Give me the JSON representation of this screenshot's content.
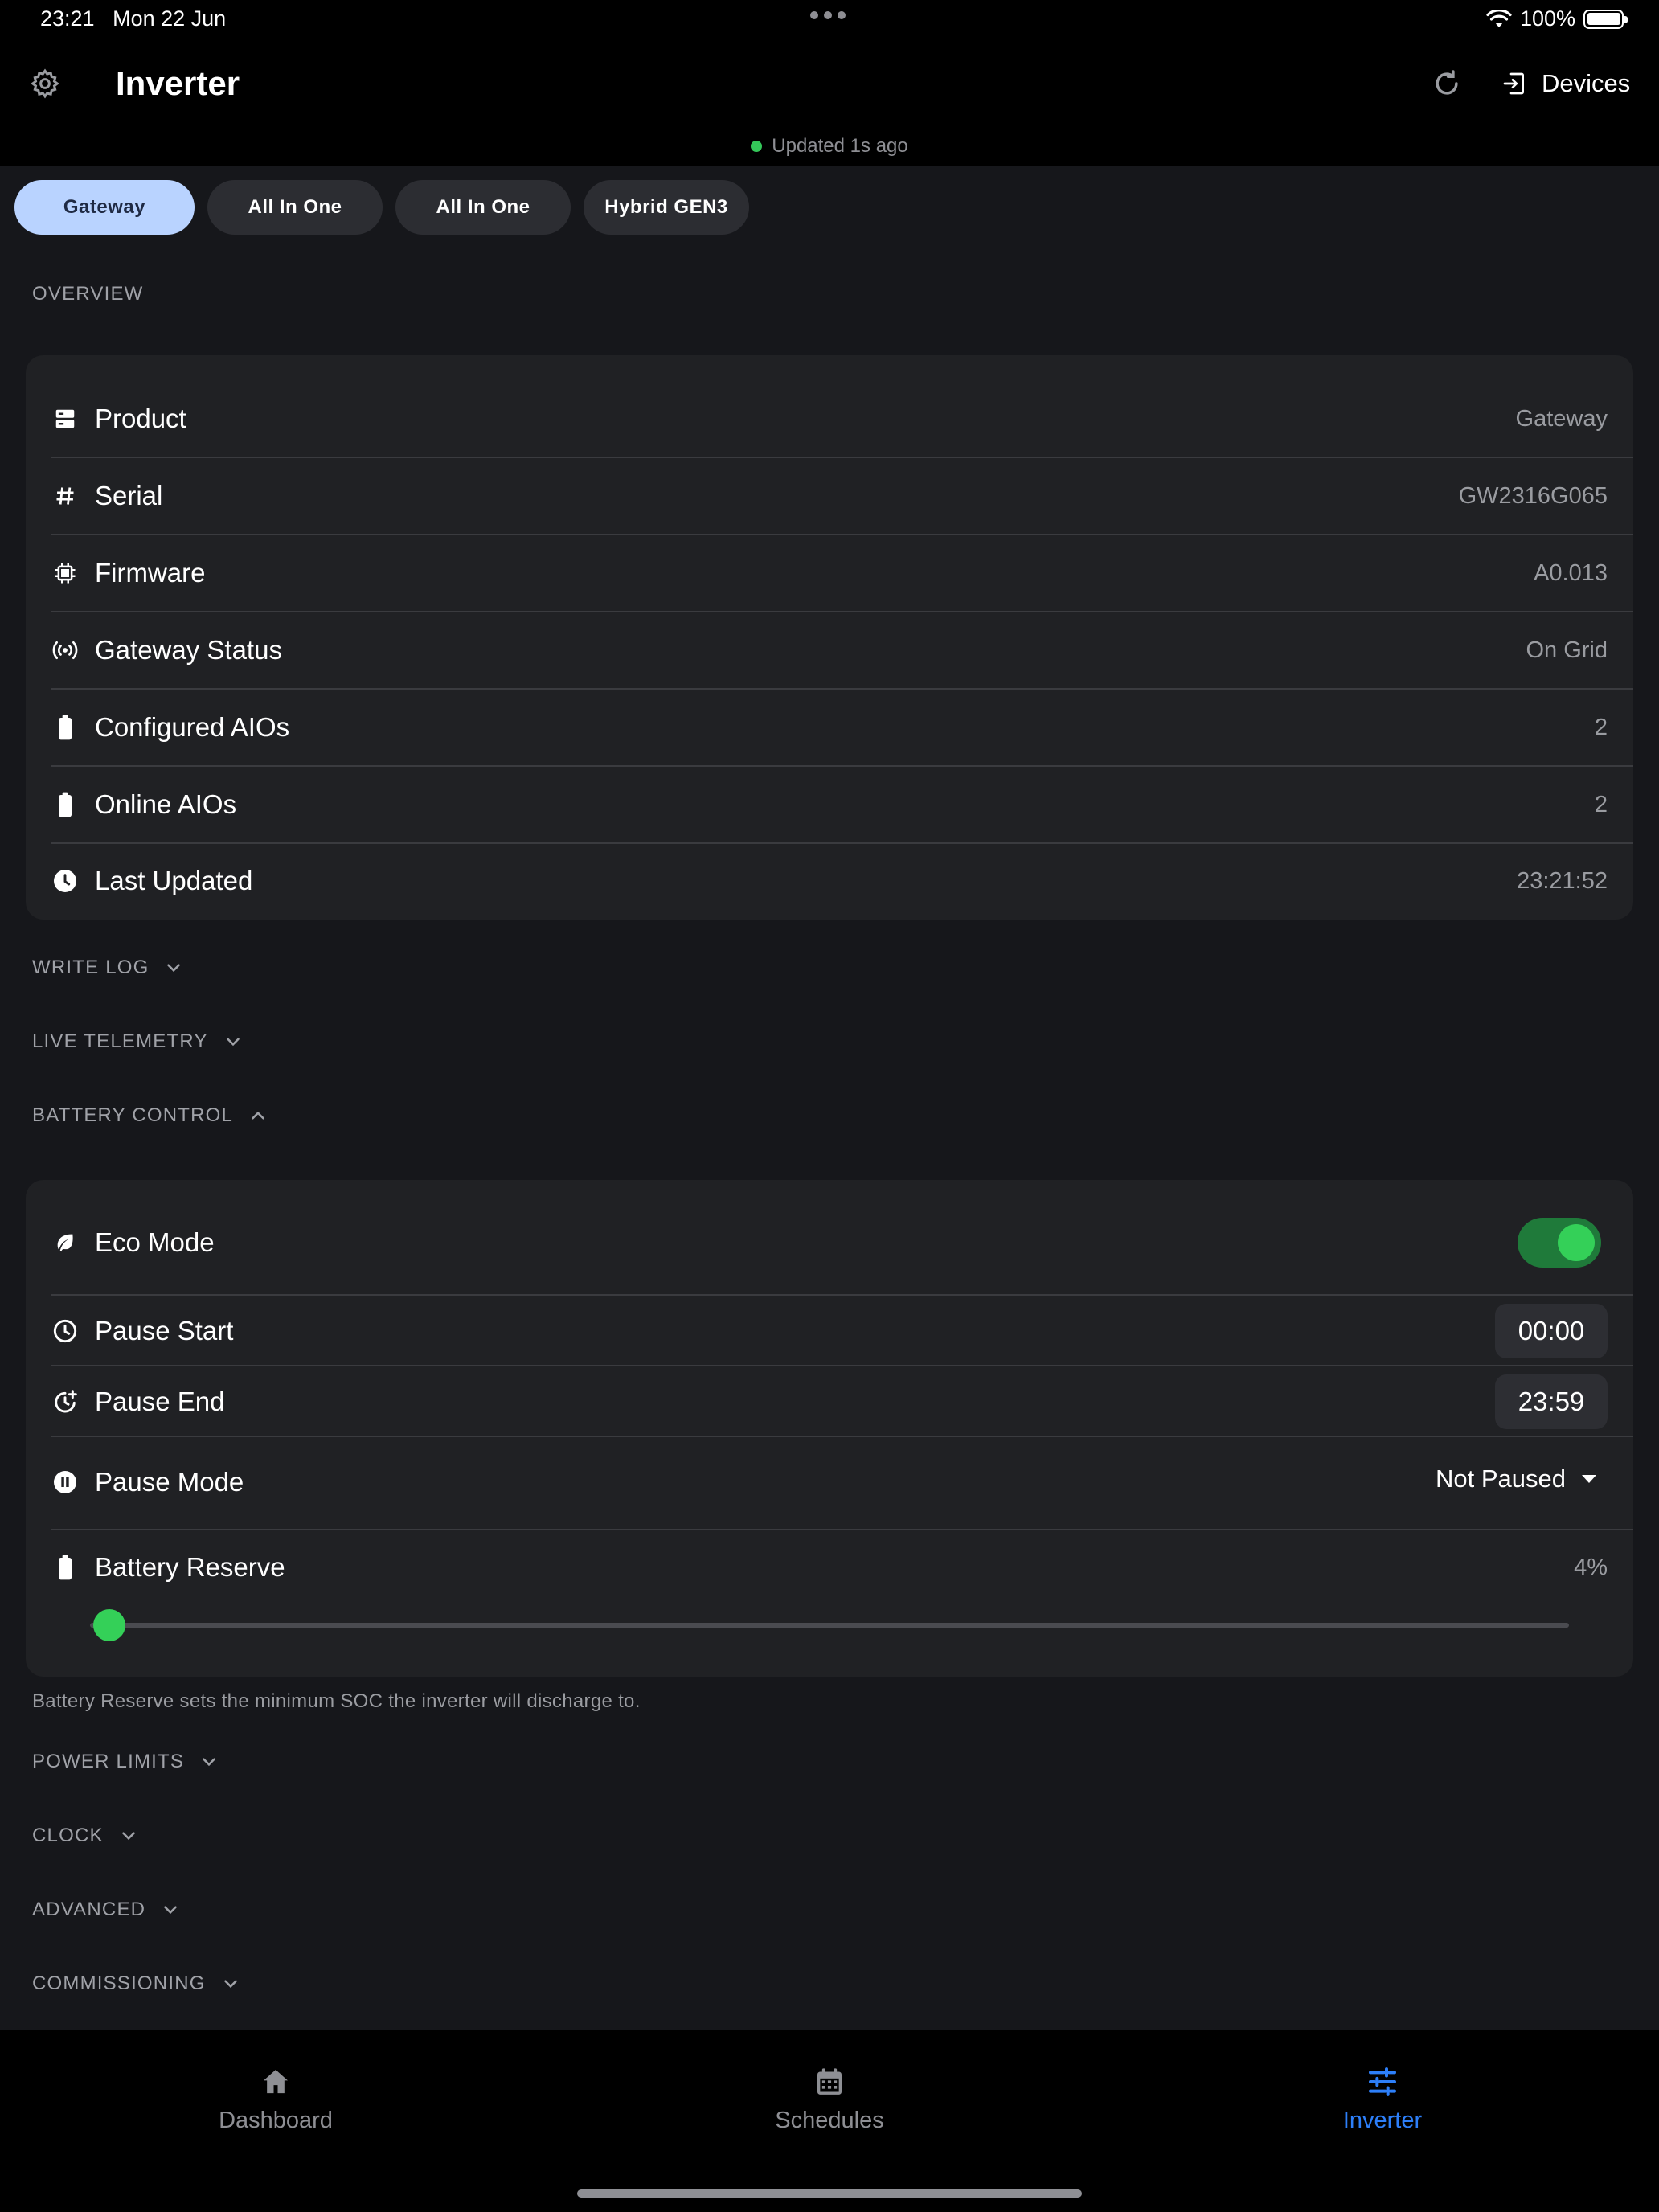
{
  "status_bar": {
    "time": "23:21",
    "date": "Mon 22 Jun",
    "battery": "100%"
  },
  "header": {
    "title": "Inverter",
    "devices_label": "Devices",
    "updated_text": "Updated 1s ago",
    "updated_color": "#34c759"
  },
  "tabs": [
    {
      "label": "Gateway",
      "active": true
    },
    {
      "label": "All In One",
      "active": false
    },
    {
      "label": "All In One",
      "active": false
    },
    {
      "label": "Hybrid GEN3",
      "active": false
    }
  ],
  "overview": {
    "section_label": "OVERVIEW",
    "rows": [
      {
        "icon": "product-icon",
        "label": "Product",
        "value": "Gateway"
      },
      {
        "icon": "hash-icon",
        "label": "Serial",
        "value": "GW2316G065"
      },
      {
        "icon": "chip-icon",
        "label": "Firmware",
        "value": "A0.013"
      },
      {
        "icon": "broadcast-icon",
        "label": "Gateway Status",
        "value": "On Grid"
      },
      {
        "icon": "battery-icon",
        "label": "Configured AIOs",
        "value": "2"
      },
      {
        "icon": "battery-icon",
        "label": "Online AIOs",
        "value": "2"
      },
      {
        "icon": "clock-icon",
        "label": "Last Updated",
        "value": "23:21:52"
      }
    ]
  },
  "sections": {
    "write_log": "WRITE LOG",
    "live_telemetry": "LIVE TELEMETRY",
    "battery_control": "BATTERY CONTROL",
    "power_limits": "POWER LIMITS",
    "clock": "CLOCK",
    "advanced": "ADVANCED",
    "commissioning": "COMMISSIONING"
  },
  "battery_control": {
    "eco_mode": {
      "label": "Eco Mode",
      "enabled": true
    },
    "pause_start": {
      "label": "Pause Start",
      "value": "00:00"
    },
    "pause_end": {
      "label": "Pause End",
      "value": "23:59"
    },
    "pause_mode": {
      "label": "Pause Mode",
      "value": "Not Paused"
    },
    "battery_reserve": {
      "label": "Battery Reserve",
      "value": "4%",
      "level": 0.04
    },
    "helper_text": "Battery Reserve sets the minimum SOC the inverter will discharge to."
  },
  "bottom_nav": [
    {
      "icon": "home-icon",
      "label": "Dashboard",
      "active": false
    },
    {
      "icon": "calendar-icon",
      "label": "Schedules",
      "active": false
    },
    {
      "icon": "sliders-icon",
      "label": "Inverter",
      "active": true
    }
  ],
  "colors": {
    "accent_green": "#34d058",
    "accent_blue": "#2d7ff9",
    "tab_active": "#b9d3ff"
  }
}
